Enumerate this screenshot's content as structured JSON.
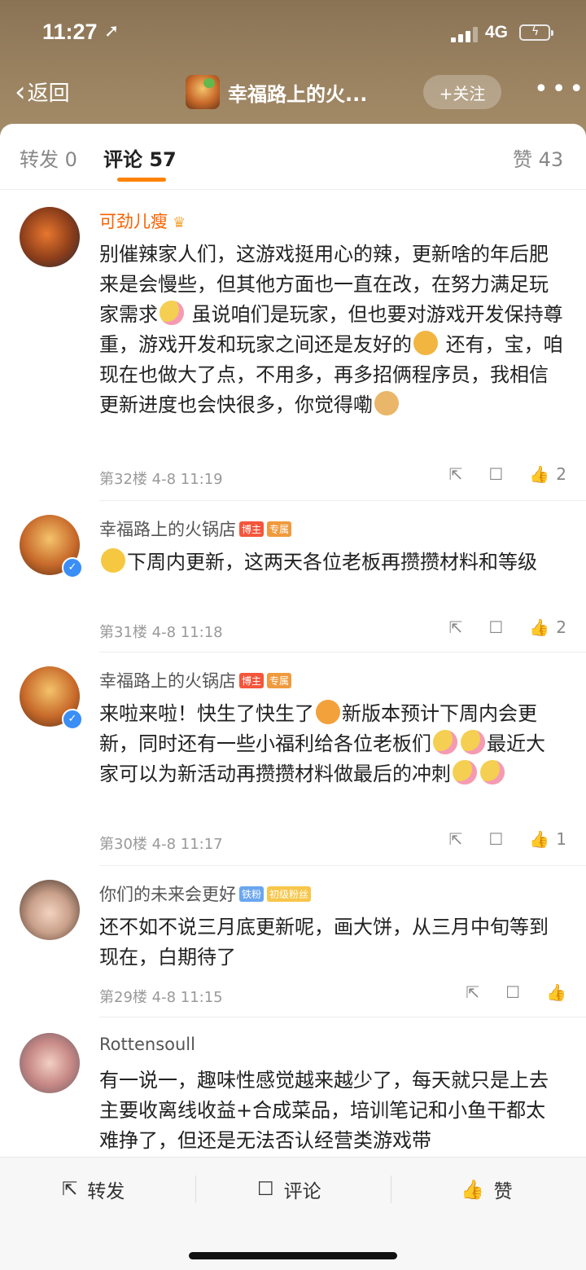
{
  "status": {
    "time": "11:27",
    "network": "4G"
  },
  "nav": {
    "back_label": "返回",
    "title": "幸福路上的火...",
    "follow_label": "+关注",
    "more_label": "•••"
  },
  "tabs": {
    "repost": "转发 0",
    "comment": "评论 57",
    "like": "赞 43"
  },
  "comments": [
    {
      "user": "可劲儿瘦",
      "text_parts": [
        "别催辣家人们，这游戏挺用心的辣，更新啥的年后肥来是会慢些，但其他方面也一直在改，在努力满足玩家需求",
        "虽说咱们是玩家，但也要对游戏开发保持尊重，游戏开发和玩家之间还是友好的",
        "还有，宝，咱现在也做大了点，不用多，再多招俩程序员，我相信更新进度也会快很多，你觉得嘞"
      ],
      "floor": "第32楼",
      "time": "4-8 11:19",
      "likes": "2"
    },
    {
      "user": "幸福路上的火锅店",
      "tag1": "博主",
      "tag2": "专属",
      "text": "下周内更新，这两天各位老板再攒攒材料和等级",
      "floor": "第31楼",
      "time": "4-8 11:18",
      "likes": "2"
    },
    {
      "user": "幸福路上的火锅店",
      "tag1": "博主",
      "tag2": "专属",
      "text_parts": [
        "来啦来啦！快生了快生了",
        "新版本预计下周内会更新，同时还有一些小福利给各位老板们",
        "最近大家可以为新活动再攒攒材料做最后的冲刺"
      ],
      "floor": "第30楼",
      "time": "4-8 11:17",
      "likes": "1"
    },
    {
      "user": "你们的未来会更好",
      "tag1": "铁粉",
      "tag2": "初级粉丝",
      "text": "还不如不说三月底更新呢，画大饼，从三月中旬等到现在，白期待了",
      "floor": "第29楼",
      "time": "4-8 11:15",
      "likes": ""
    },
    {
      "user": "Rottensoull",
      "text": "有一说一，趣味性感觉越来越少了，每天就只是上去主要收离线收益+合成菜品，培训笔记和小鱼干都太难挣了，但还是无法否认经营类游戏带"
    }
  ],
  "bottom": {
    "repost": "转发",
    "comment": "评论",
    "like": "赞"
  },
  "icons": {
    "share": "share-icon",
    "comment": "comment-icon",
    "like": "thumbs-up-icon"
  },
  "colors": {
    "accent": "#ff8200",
    "vip_name": "#f86200",
    "verified": "#3a8ef5"
  }
}
